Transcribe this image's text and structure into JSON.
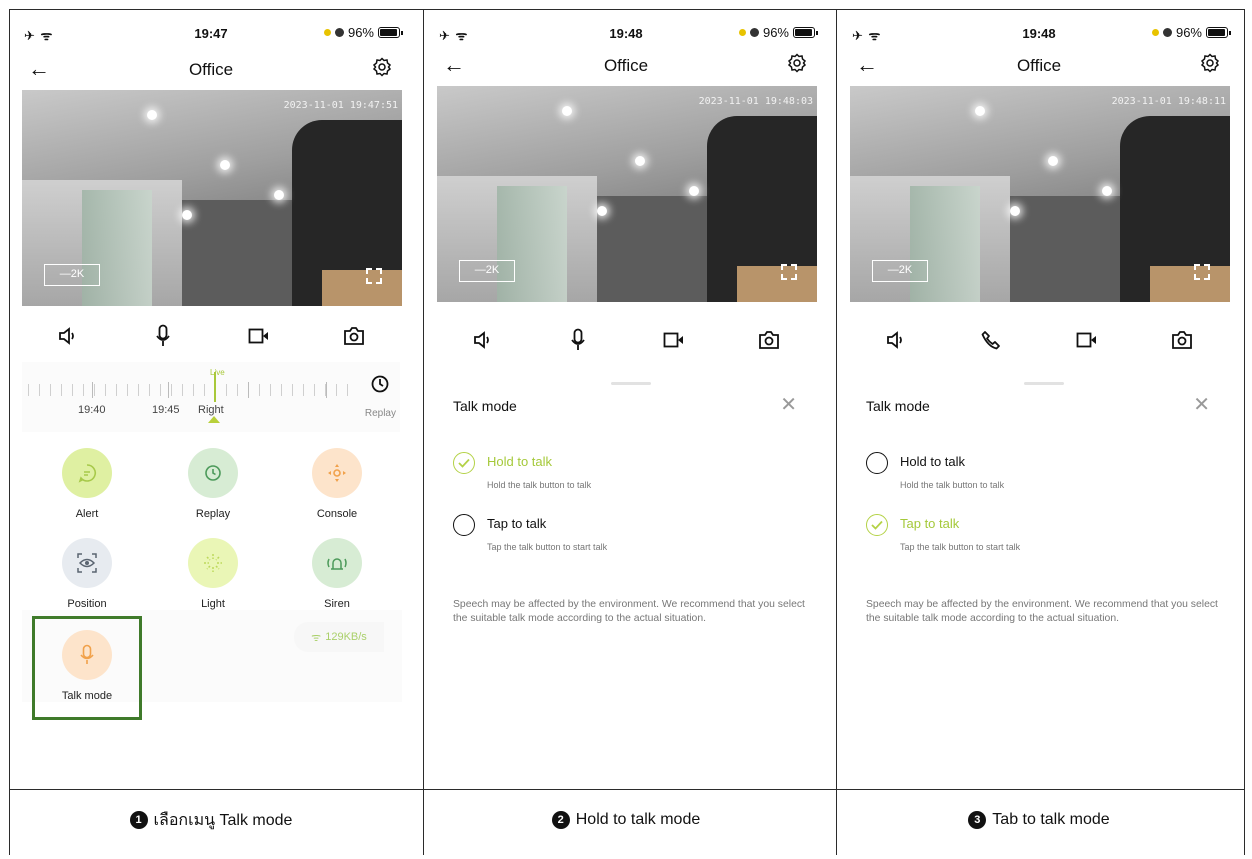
{
  "panels": [
    {
      "status": {
        "left": "✈ ᯤ",
        "time": "19:47",
        "battery": "96%"
      },
      "nav": {
        "title": "Office"
      },
      "video": {
        "timestamp": "2023-11-01 19:47:51",
        "quality": "—2K"
      },
      "timeline": {
        "live": "Live",
        "labels": [
          "19:40",
          "19:45",
          "Right"
        ],
        "replay": "Replay"
      },
      "features": [
        "Alert",
        "Replay",
        "Console",
        "Position",
        "Light",
        "Siren",
        "Talk mode"
      ],
      "speed": "129KB/s",
      "caption": {
        "num": "1",
        "text": "เลือกเมนู Talk mode"
      }
    },
    {
      "status": {
        "left": "✈ ᯤ",
        "time": "19:48",
        "battery": "96%"
      },
      "nav": {
        "title": "Office"
      },
      "video": {
        "timestamp": "2023-11-01 19:48:03",
        "quality": "—2K"
      },
      "sheet": {
        "title": "Talk mode",
        "options": [
          {
            "name": "Hold to talk",
            "desc": "Hold the talk button to talk",
            "selected": true
          },
          {
            "name": "Tap to talk",
            "desc": "Tap the talk button to start talk",
            "selected": false
          }
        ],
        "note": "Speech may be affected by the environment. We recommend that you select the suitable talk mode according to the actual situation."
      },
      "caption": {
        "num": "2",
        "text": "Hold to talk mode"
      }
    },
    {
      "status": {
        "left": "✈ ᯤ",
        "time": "19:48",
        "battery": "96%"
      },
      "nav": {
        "title": "Office"
      },
      "video": {
        "timestamp": "2023-11-01 19:48:11",
        "quality": "—2K"
      },
      "sheet": {
        "title": "Talk mode",
        "options": [
          {
            "name": "Hold to talk",
            "desc": "Hold the talk button to talk",
            "selected": false
          },
          {
            "name": "Tap to talk",
            "desc": "Tap the talk button to start talk",
            "selected": true
          }
        ],
        "note": "Speech may be affected by the environment. We recommend that you select the suitable talk mode according to the actual situation."
      },
      "caption": {
        "num": "3",
        "text": "Tab to talk mode"
      }
    }
  ],
  "colors": {
    "accent": "#a5c93a",
    "highlight": "#3f7a2a"
  }
}
